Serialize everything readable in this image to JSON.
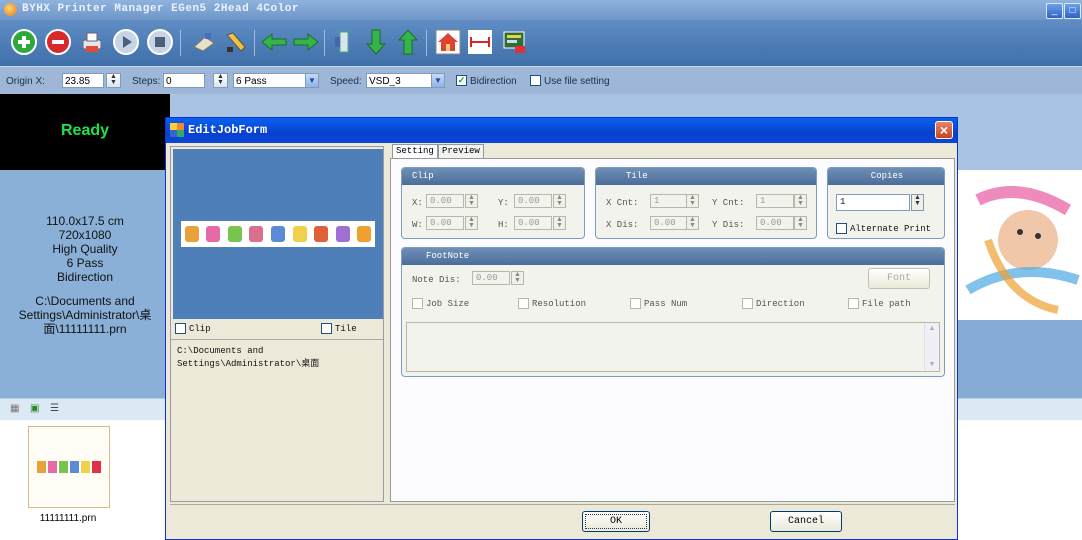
{
  "window": {
    "title": "BYHX  Printer Manager EGen5 2Head 4Color"
  },
  "toolbar": {
    "icons": [
      "add-icon",
      "delete-icon",
      "print-icon",
      "play-icon",
      "stop-icon",
      "clean-icon",
      "tool-icon",
      "move-left-icon",
      "move-right-icon",
      "stand-icon",
      "move-down-icon",
      "move-up-icon",
      "home-icon",
      "measure-icon",
      "settings-icon"
    ]
  },
  "options": {
    "origin_label": "Origin X:",
    "origin_value": "23.85",
    "steps_label": "Steps:",
    "steps_value": "0",
    "pass_value": "6 Pass",
    "speed_label": "Speed:",
    "speed_value": "VSD_3",
    "bidirection_label": "Bidirection",
    "bidirection_checked": true,
    "file_setting_label": "Use file setting",
    "file_setting_checked": false
  },
  "status": {
    "text": "Ready",
    "color": "#22e04a"
  },
  "job_info": {
    "size": "110.0x17.5 cm",
    "resolution": "720x1080",
    "quality": "High Quality",
    "pass": "6 Pass",
    "direction": "Bidirection",
    "path_line1": "C:\\Documents and",
    "path_line2": "Settings\\Administrator\\桌",
    "path_line3": "面\\11111111.prn"
  },
  "thumbnail": {
    "label": "11111111.prn"
  },
  "dialog": {
    "title": "EditJobForm",
    "clip_label": "Clip",
    "tile_label": "Tile",
    "path_line1": "C:\\Documents and",
    "path_line2": "Settings\\Administrator\\桌面",
    "tabs": {
      "setting": "Setting",
      "preview": "Preview"
    },
    "clip": {
      "header": "Clip",
      "x_label": "X:",
      "x": "0.00",
      "y_label": "Y:",
      "y": "0.00",
      "w_label": "W:",
      "w": "0.00",
      "h_label": "H:",
      "h": "0.00"
    },
    "tile": {
      "header": "Tile",
      "xcnt_label": "X Cnt:",
      "xcnt": "1",
      "ycnt_label": "Y Cnt:",
      "ycnt": "1",
      "xdis_label": "X Dis:",
      "xdis": "0.00",
      "ydis_label": "Y Dis:",
      "ydis": "0.00"
    },
    "copies": {
      "header": "Copies",
      "value": "1",
      "alternate_label": "Alternate Print"
    },
    "footnote": {
      "header": "FootNote",
      "note_label": "Note Dis:",
      "note_value": "0.00",
      "font_label": "Font",
      "options": [
        "Job Size",
        "Resolution",
        "Pass Num",
        "Direction",
        "File path"
      ]
    },
    "ok_label": "OK",
    "cancel_label": "Cancel"
  }
}
